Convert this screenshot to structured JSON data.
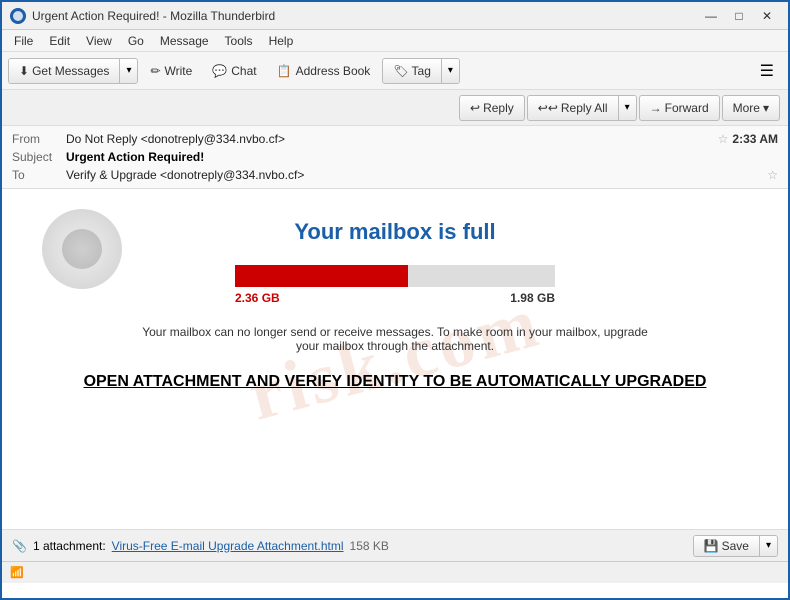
{
  "titlebar": {
    "title": "Urgent Action Required! - Mozilla Thunderbird",
    "minimize": "—",
    "maximize": "□",
    "close": "✕"
  },
  "menubar": {
    "items": [
      "File",
      "Edit",
      "View",
      "Go",
      "Message",
      "Tools",
      "Help"
    ]
  },
  "toolbar": {
    "get_messages_label": "Get Messages",
    "write_label": "Write",
    "chat_label": "Chat",
    "address_book_label": "Address Book",
    "tag_label": "Tag"
  },
  "action_bar": {
    "reply_label": "Reply",
    "reply_all_label": "Reply All",
    "forward_label": "Forward",
    "more_label": "More"
  },
  "email_header": {
    "from_label": "From",
    "from_value": "Do Not Reply <donotreply@334.nvbo.cf>",
    "subject_label": "Subject",
    "subject_value": "Urgent Action Required!",
    "to_label": "To",
    "to_value": "Verify & Upgrade <donotreply@334.nvbo.cf>",
    "time": "2:33 AM"
  },
  "email_body": {
    "title": "Your mailbox is full",
    "storage_used": "2.36 GB",
    "storage_remaining": "1.98 GB",
    "storage_percent": 54,
    "description": "Your mailbox can no longer send or receive messages. To make room in your mailbox, upgrade your mailbox through the attachment.",
    "cta": "OPEN ATTACHMENT AND VERIFY IDENTITY TO BE AUTOMATICALLY UPGRADED",
    "watermark": "risk.com"
  },
  "attachment_bar": {
    "count": "1 attachment:",
    "filename": "Virus-Free E-mail Upgrade Attachment.html",
    "size": "158 KB",
    "save_label": "Save"
  },
  "status_bar": {
    "icon": "📶"
  }
}
